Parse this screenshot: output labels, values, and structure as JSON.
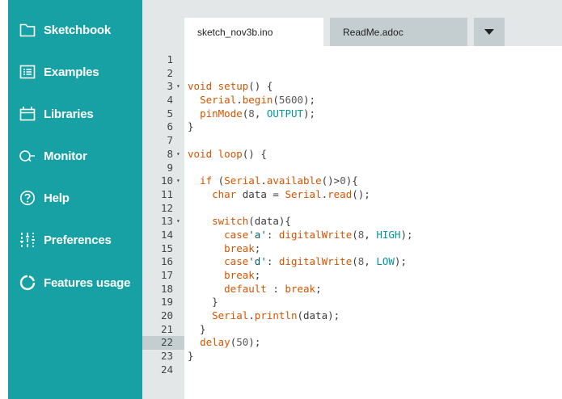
{
  "sidebar": {
    "items": [
      {
        "label": "Sketchbook",
        "icon": "folder-icon"
      },
      {
        "label": "Examples",
        "icon": "list-icon"
      },
      {
        "label": "Libraries",
        "icon": "library-icon"
      },
      {
        "label": "Monitor",
        "icon": "monitor-icon"
      },
      {
        "label": "Help",
        "icon": "help-icon"
      },
      {
        "label": "Preferences",
        "icon": "sliders-icon"
      },
      {
        "label": "Features usage",
        "icon": "pie-icon"
      }
    ]
  },
  "tabs": [
    {
      "label": "sketch_nov3b.ino",
      "active": true
    },
    {
      "label": "ReadMe.adoc",
      "active": false
    }
  ],
  "dropdown_icon": "caret-down-icon",
  "colors": {
    "sidebar": "#17a1a5",
    "keyword": "#d35400",
    "constant": "#00979c",
    "tab_inactive": "#c4ced0"
  },
  "editor": {
    "highlighted_line": 22,
    "lines": [
      "",
      "",
      "void setup() {",
      "  Serial.begin(5600);",
      "  pinMode(8, OUTPUT);",
      "}",
      "",
      "void loop() {",
      "",
      "  if (Serial.available()>0){",
      "    char data = Serial.read();",
      "",
      "    switch(data){",
      "      case'a': digitalWrite(8, HIGH);",
      "      break;",
      "      case'd': digitalWrite(8, LOW);",
      "      break;",
      "      default : break;",
      "    }",
      "    Serial.println(data);",
      "  }",
      "  delay(50);",
      "}",
      ""
    ],
    "fold_lines": [
      3,
      8,
      10,
      13
    ]
  }
}
